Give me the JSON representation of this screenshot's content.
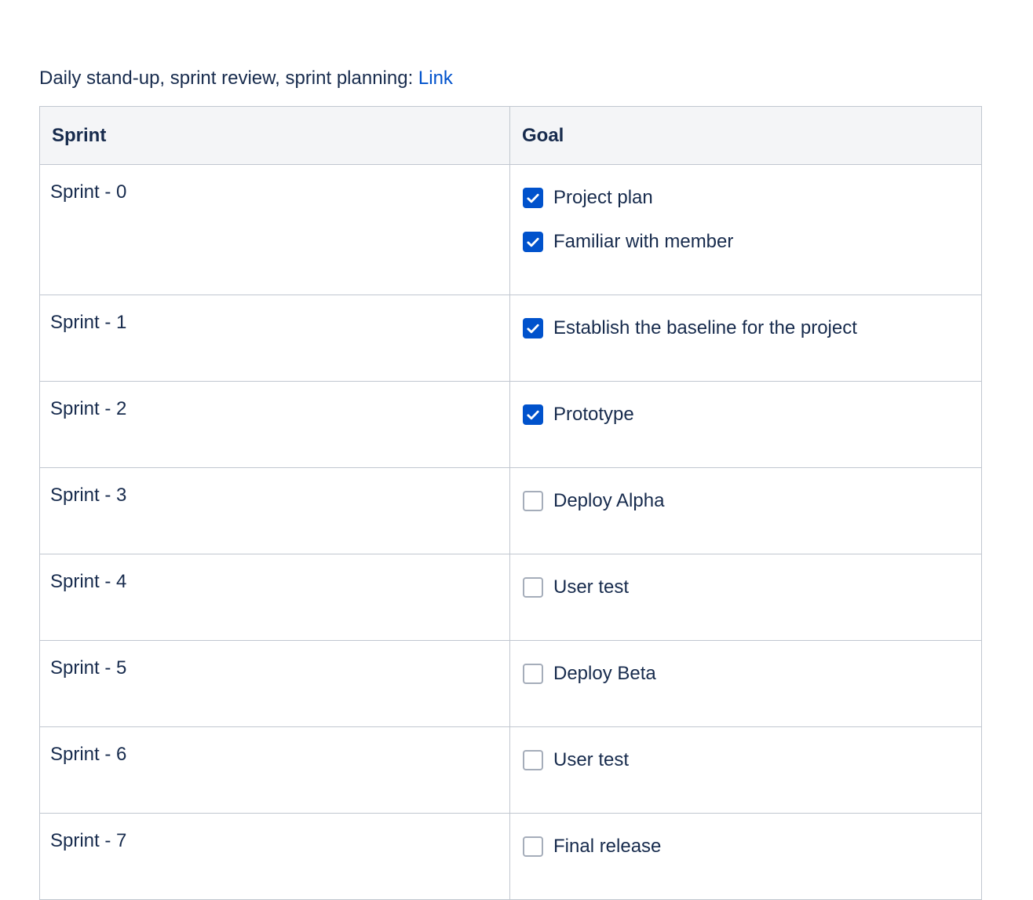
{
  "intro": {
    "text": "Daily stand-up, sprint review, sprint planning: ",
    "link_label": "Link"
  },
  "table": {
    "headers": [
      "Sprint",
      "Goal"
    ],
    "rows": [
      {
        "sprint": "Sprint - 0",
        "goals": [
          {
            "label": "Project plan",
            "checked": true
          },
          {
            "label": "Familiar with member",
            "checked": true
          }
        ]
      },
      {
        "sprint": "Sprint - 1",
        "goals": [
          {
            "label": "Establish the baseline for the project",
            "checked": true
          }
        ]
      },
      {
        "sprint": "Sprint - 2",
        "goals": [
          {
            "label": "Prototype",
            "checked": true
          }
        ]
      },
      {
        "sprint": "Sprint - 3",
        "goals": [
          {
            "label": "Deploy Alpha",
            "checked": false
          }
        ]
      },
      {
        "sprint": "Sprint - 4",
        "goals": [
          {
            "label": "User test",
            "checked": false
          }
        ]
      },
      {
        "sprint": "Sprint - 5",
        "goals": [
          {
            "label": "Deploy Beta",
            "checked": false
          }
        ]
      },
      {
        "sprint": "Sprint - 6",
        "goals": [
          {
            "label": "User test",
            "checked": false
          }
        ]
      },
      {
        "sprint": "Sprint - 7",
        "goals": [
          {
            "label": "Final release",
            "checked": false
          }
        ]
      }
    ]
  },
  "colors": {
    "text": "#172b4d",
    "link": "#0052cc",
    "checkbox_checked": "#0052cc",
    "checkbox_unchecked_border": "#a5adba",
    "header_bg": "#f4f5f7",
    "border": "#c1c7d0"
  },
  "icons": {
    "checked": "checkmark-icon"
  }
}
